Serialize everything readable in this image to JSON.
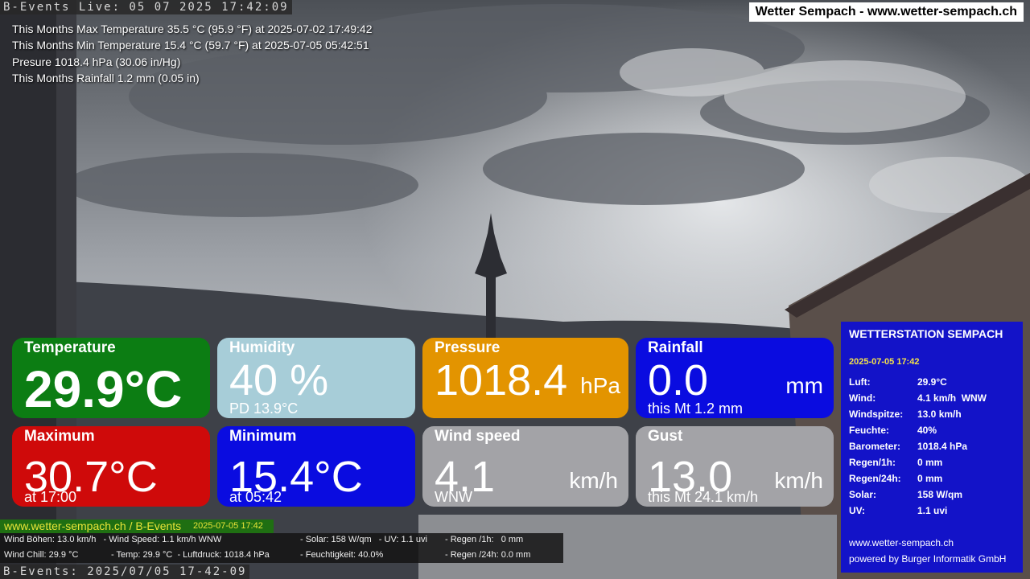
{
  "camera": {
    "top_stamp": "B-Events Live: 05 07 2025 17:42:09",
    "bottom_stamp": "B-Events: 2025/07/05 17-42-09"
  },
  "site_title": "Wetter Sempach - www.wetter-sempach.ch",
  "month_stats": [
    "This Months Max Temperature 35.5 °C (95.9 °F) at 2025-07-02 17:49:42",
    "This Months Min Temperature 15.4 °C (59.7 °F) at 2025-07-05 05:42:51",
    "Presure 1018.4 hPa (30.06 in/Hg)",
    "This Months Rainfall 1.2 mm (0.05 in)"
  ],
  "tiles": {
    "temperature": {
      "title": "Temperature",
      "value": "29.9°C"
    },
    "humidity": {
      "title": "Humidity",
      "value": "40 %",
      "sub": "PD 13.9°C"
    },
    "pressure": {
      "title": "Pressure",
      "value": "1018.4",
      "unit": "hPa"
    },
    "rainfall": {
      "title": "Rainfall",
      "value": "0.0",
      "unit": "mm",
      "sub": "this Mt 1.2 mm"
    },
    "maximum": {
      "title": "Maximum",
      "value": "30.7°C",
      "sub": "at 17:00"
    },
    "minimum": {
      "title": "Minimum",
      "value": "15.4°C",
      "sub": "at 05:42"
    },
    "windspeed": {
      "title": "Wind speed",
      "value": "4.1",
      "unit": "km/h",
      "sub": "WNW"
    },
    "gust": {
      "title": "Gust",
      "value": "13.0",
      "unit": "km/h",
      "sub": "this Mt 24.1 km/h"
    }
  },
  "station": {
    "heading": "WETTERSTATION SEMPACH",
    "timestamp": "2025-07-05 17:42",
    "rows": [
      {
        "k": "Luft:",
        "v": "29.9°C"
      },
      {
        "k": "Wind:",
        "v": "4.1 km/h  WNW"
      },
      {
        "k": "Windspitze:",
        "v": "13.0 km/h"
      },
      {
        "k": "Feuchte:",
        "v": "40%"
      },
      {
        "k": "Barometer:",
        "v": "1018.4 hPa"
      },
      {
        "k": "Regen/1h:",
        "v": "0 mm"
      },
      {
        "k": "Regen/24h:",
        "v": "0 mm"
      },
      {
        "k": "Solar:",
        "v": "158 W/qm"
      },
      {
        "k": "UV:",
        "v": "1.1 uvi"
      }
    ],
    "url": "www.wetter-sempach.ch",
    "powered": "powered by Burger Informatik GmbH"
  },
  "ticker": {
    "url": "www.wetter-sempach.ch / B-Events",
    "timestamp": "2025-07-05 17:42",
    "line1_a": "Wind Böhen: 13.0 km/h   - Wind Speed: 1.1 km/h WNW",
    "line1_b": "- Solar: 158 W/qm   - UV: 1.1 uvi",
    "line1_c": "- Regen /1h:   0 mm",
    "line2_a": "Wind Chill: 29.9 °C",
    "line2_b": "- Temp: 29.9 °C  - Luftdruck: 1018.4 hPa",
    "line2_c": "- Feuchtigkeit: 40.0%",
    "line2_d": "- Regen /24h: 0.0 mm"
  },
  "colors": {
    "green": "#0c7d13",
    "lightblue": "#a7cdd8",
    "orange": "#e39400",
    "blue": "#0a0ce0",
    "red": "#cf0a0a",
    "gray": "#a3a3a7",
    "station": "#1313c8"
  }
}
